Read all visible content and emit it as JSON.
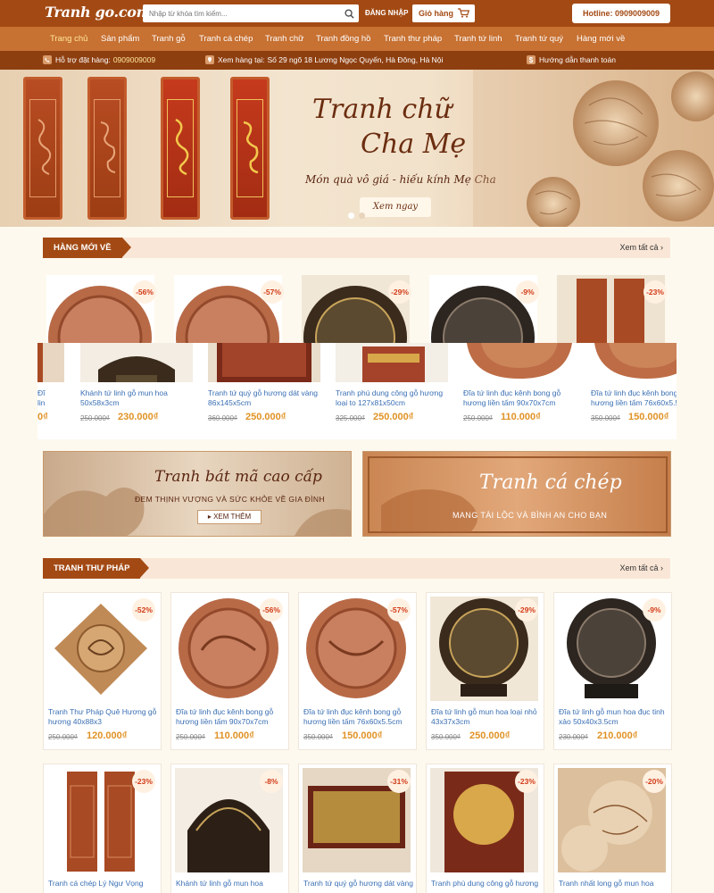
{
  "header": {
    "logo": "Tranh go.com.vn",
    "search_placeholder": "Nhập từ khóa tìm kiếm...",
    "login": "ĐĂNG NHẬP",
    "cart": "Giỏ hàng",
    "hotline": "Hotline: 0909009009"
  },
  "nav": [
    "Trang chủ",
    "Sản phẩm",
    "Tranh gỗ",
    "Tranh cá chép",
    "Tranh chữ",
    "Tranh đồng hồ",
    "Tranh thư pháp",
    "Tranh tứ linh",
    "Tranh tứ quý",
    "Hàng mới về"
  ],
  "infobar": {
    "support_label": "Hỗ trợ đặt hàng:",
    "support_phone": "0909009009",
    "store_label": "Xem hàng tại:",
    "store_address": "Số 29 ngõ 18 Lương Ngọc Quyến, Hà Đông, Hà Nội",
    "payment": "Hướng dẫn thanh toán"
  },
  "banner": {
    "title_line1": "Tranh chữ",
    "title_line2": "Cha Mẹ",
    "subtitle": "Món quà vô giá - hiếu kính Mẹ Cha",
    "button": "Xem ngay"
  },
  "section_new": {
    "title": "HÀNG MỚI VỀ",
    "see_all": "Xem tất cả",
    "badges": [
      "-56%",
      "-57%",
      "-29%",
      "-9%",
      "-23%"
    ],
    "strip": [
      {
        "name": "",
        "old": "",
        "price": ""
      },
      {
        "name": "Khánh tứ linh gỗ mun hoa 50x58x3cm",
        "old": "250.000₫",
        "price": "230.000₫"
      },
      {
        "name": "Tranh tứ quý gỗ hương dát vàng 86x145x5cm",
        "old": "360.000₫",
        "price": "250.000₫"
      },
      {
        "name": "Tranh phú dung công gỗ hương loại to 127x81x50cm",
        "old": "325.000₫",
        "price": "250.000₫"
      },
      {
        "name": "Đĩa tứ linh đục kênh bong gỗ hương liền tấm 90x70x7cm",
        "old": "250.000₫",
        "price": "110.000₫"
      },
      {
        "name": "Đĩa tứ linh đục kênh bong gỗ hương liền tấm 76x60x5.5cm",
        "old": "350.000₫",
        "price": "150.000₫"
      }
    ]
  },
  "promos": {
    "left_title": "Tranh bát mã cao cấp",
    "left_sub": "ĐEM THỊNH VƯỢNG VÀ SỨC KHỎE VỀ GIA ĐÌNH",
    "left_button": "XEM THÊM",
    "right_title": "Tranh cá chép",
    "right_sub": "MANG TÀI LỘC VÀ BÌNH AN CHO BẠN"
  },
  "section_thuphap": {
    "title": "TRANH THƯ PHÁP",
    "see_all": "Xem tất cả",
    "row1": [
      {
        "name": "Tranh Thư Pháp Quê Hương gỗ hương 40x88x3",
        "old": "250.000₫",
        "price": "120.000₫",
        "badge": "-52%"
      },
      {
        "name": "Đĩa tứ linh đục kênh bong gỗ hương liền tấm 90x70x7cm",
        "old": "250.000₫",
        "price": "110.000₫",
        "badge": "-56%"
      },
      {
        "name": "Đĩa tứ linh đục kênh bong gỗ hương liền tấm 76x60x5.5cm",
        "old": "350.000₫",
        "price": "150.000₫",
        "badge": "-57%"
      },
      {
        "name": "Đĩa tứ linh gỗ mun hoa loại nhỏ 43x37x3cm",
        "old": "350.000₫",
        "price": "250.000₫",
        "badge": "-29%"
      },
      {
        "name": "Đĩa tứ linh gỗ mun hoa đục tinh xảo 50x40x3.5cm",
        "old": "230.000₫",
        "price": "210.000₫",
        "badge": "-9%"
      }
    ],
    "row2": [
      {
        "name": "Tranh cá chép Lý Ngư Vọng",
        "badge": "-23%"
      },
      {
        "name": "Khánh tứ linh gỗ mun hoa",
        "badge": "-8%"
      },
      {
        "name": "Tranh tứ quý gỗ hương dát vàng",
        "badge": "-31%"
      },
      {
        "name": "Tranh phù dung công gỗ hương",
        "badge": "-23%"
      },
      {
        "name": "Tranh nhất long gỗ mun hoa",
        "badge": "-20%"
      }
    ]
  }
}
